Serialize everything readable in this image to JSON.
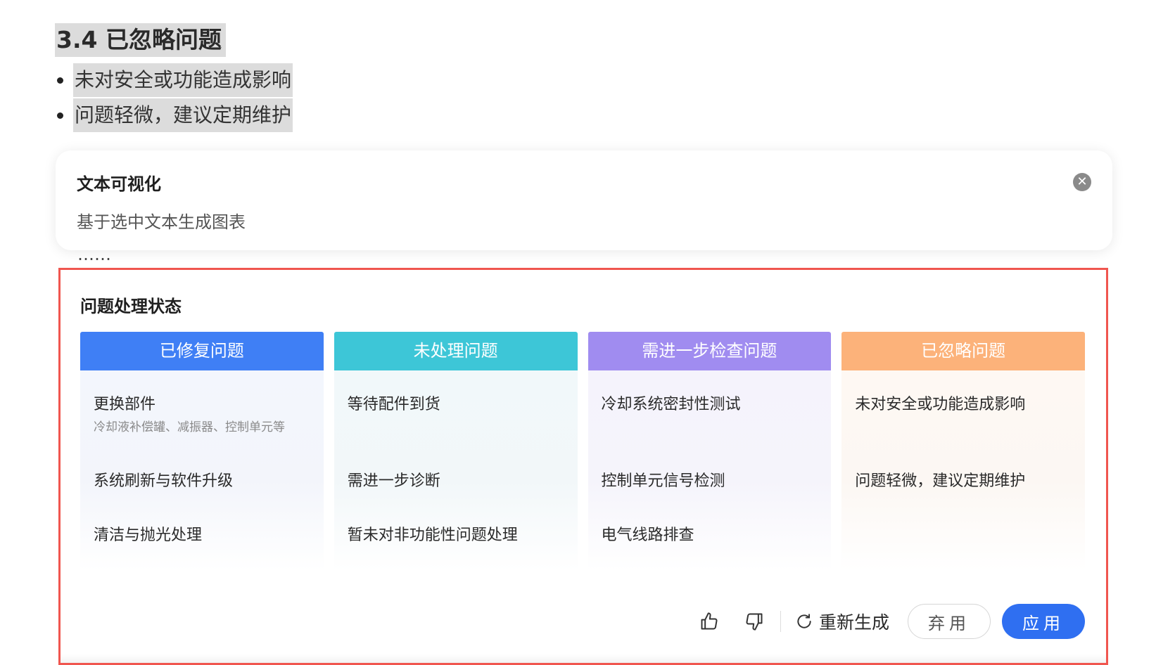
{
  "document": {
    "heading": "3.4 已忽略问题",
    "bullets": [
      "未对安全或功能造成影响",
      "问题轻微，建议定期维护"
    ],
    "obscured_line": "……"
  },
  "viz_popup": {
    "title": "文本可视化",
    "subtitle": "基于选中文本生成图表",
    "close_symbol": "✕"
  },
  "result": {
    "title": "问题处理状态",
    "columns": [
      {
        "header": "已修复问题",
        "color": "#3f7ff5",
        "bg_tint": "#eef2fc",
        "items": [
          {
            "label": "更换部件",
            "sub": "冷却液补偿罐、减振器、控制单元等"
          },
          {
            "label": "系统刷新与软件升级"
          },
          {
            "label": "清洁与抛光处理"
          }
        ]
      },
      {
        "header": "未处理问题",
        "color": "#3dc6d7",
        "bg_tint": "#edf7f9",
        "items": [
          {
            "label": "等待配件到货"
          },
          {
            "label": "需进一步诊断"
          },
          {
            "label": "暂未对非功能性问题处理"
          }
        ]
      },
      {
        "header": "需进一步检查问题",
        "color": "#a08cf0",
        "bg_tint": "#f2f0fb",
        "items": [
          {
            "label": "冷却系统密封性测试"
          },
          {
            "label": "控制单元信号检测"
          },
          {
            "label": "电气线路排查"
          }
        ]
      },
      {
        "header": "已忽略问题",
        "color": "#fcb27a",
        "bg_tint": "#fdf6f0",
        "items": [
          {
            "label": "未对安全或功能造成影响"
          },
          {
            "label": "问题轻微，建议定期维护"
          }
        ]
      }
    ],
    "actions": {
      "like_icon": "thumbs-up-icon",
      "dislike_icon": "thumbs-down-icon",
      "regenerate_label": "重新生成",
      "discard_label": "弃用",
      "apply_label": "应用"
    }
  }
}
